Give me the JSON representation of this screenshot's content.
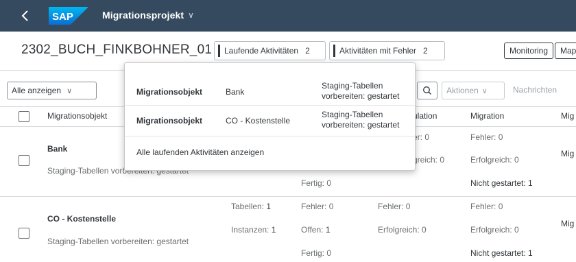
{
  "shell": {
    "logo_text": "SAP",
    "app_title": "Migrationsprojekt",
    "title_chevron": "∨",
    "colors": {
      "shell_bg": "#354a5f",
      "logo_blue": "#0a6ed1"
    }
  },
  "header": {
    "object_title": "2302_BUCH_FINKBOHNER_01",
    "running_label": "Laufende Aktivitäten",
    "running_count": "2",
    "error_label": "Aktivitäten mit Fehler",
    "error_count": "2",
    "monitoring_label": "Monitoring",
    "map_label": "Map"
  },
  "filter": {
    "show_all": "Alle anzeigen",
    "actions": "Aktionen",
    "messages": "Nachrichten"
  },
  "table": {
    "columns": {
      "object": "Migrationsobjekt",
      "simulation": "ulation",
      "migration": "Migration",
      "extra": "Mig"
    },
    "rows": [
      {
        "name": "Bank",
        "status": "Staging-Tabellen vorbereiten: gestartet",
        "sim_fehler_label": "er:",
        "sim_fehler": "0",
        "sim_erfolg_label": "greich:",
        "sim_erfolg": "0",
        "fertig_label": "Fertig:",
        "fertig": "0",
        "mig_fehler_label": "Fehler:",
        "mig_fehler": "0",
        "mig_erfolg_label": "Erfolgreich:",
        "mig_erfolg": "0",
        "mig_nicht_label": "Nicht gestartet:",
        "mig_nicht": "1",
        "extra": "Mig"
      },
      {
        "name": "CO - Kostenstelle",
        "status": "Staging-Tabellen vorbereiten: gestartet",
        "tabellen_label": "Tabellen:",
        "tabellen": "1",
        "instanzen_label": "Instanzen:",
        "instanzen": "1",
        "fehler_label": "Fehler:",
        "fehler": "0",
        "offen_label": "Offen:",
        "offen": "1",
        "fertig_label": "Fertig:",
        "fertig": "0",
        "sim_fehler_label": "Fehler:",
        "sim_fehler": "0",
        "sim_erfolg_label": "Erfolgreich:",
        "sim_erfolg": "0",
        "mig_fehler_label": "Fehler:",
        "mig_fehler": "0",
        "mig_erfolg_label": "Erfolgreich:",
        "mig_erfolg": "0",
        "mig_nicht_label": "Nicht gestartet:",
        "mig_nicht": "1",
        "extra": "Mig"
      }
    ]
  },
  "popover": {
    "items": [
      {
        "key": "Migrationsobjekt",
        "value": "Bank",
        "status": "Staging-Tabellen vorbereiten: gestartet"
      },
      {
        "key": "Migrationsobjekt",
        "value": "CO - Kostenstelle",
        "status": "Staging-Tabellen vorbereiten: gestartet"
      }
    ],
    "link": "Alle laufenden Aktivitäten anzeigen"
  }
}
